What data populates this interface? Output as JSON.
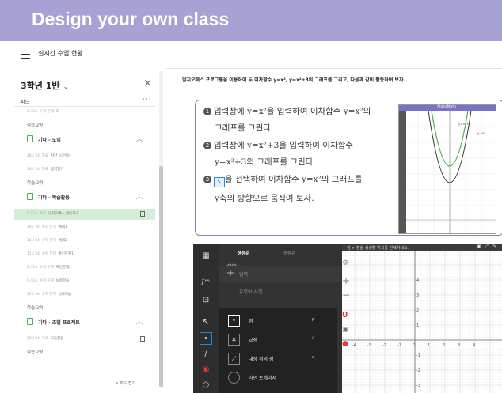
{
  "banner": {
    "title": "Design your own class"
  },
  "topbar": {
    "title": "실시간 수업 현황"
  },
  "sidebar": {
    "class_name": "3학년 1반",
    "class_chevron": "⌄",
    "close": "×",
    "tab": "피드",
    "more": "···",
    "items": [
      {
        "kind": "meta",
        "date": "1 / 24",
        "tag": "수학 문제",
        "title": "도"
      },
      {
        "kind": "plain",
        "text": "학습요약"
      },
      {
        "kind": "section",
        "label": "기타 - 도입"
      },
      {
        "kind": "meta",
        "date": "16 / 24",
        "tag": "자료",
        "title": "지난 시간에는"
      },
      {
        "kind": "meta",
        "date": "16 / 24",
        "tag": "자료",
        "title": "생각열기"
      },
      {
        "kind": "plain",
        "text": "학습요약"
      },
      {
        "kind": "section",
        "label": "기타 - 학습활동"
      },
      {
        "kind": "active",
        "date": "0 / 24",
        "tag": "자료",
        "title": "알지오매스 활동하기"
      },
      {
        "kind": "meta",
        "date": "16 / 24",
        "tag": "수학 문제",
        "title": "예제1"
      },
      {
        "kind": "meta",
        "date": "16 / 24",
        "tag": "수학 문제",
        "title": "예제2"
      },
      {
        "kind": "meta",
        "date": "11 / 24",
        "tag": "수학 문제",
        "title": "확인문제1"
      },
      {
        "kind": "meta",
        "date": "1 / 24",
        "tag": "수학 문제",
        "title": "확인문제2"
      },
      {
        "kind": "meta",
        "date": "0 / 24",
        "tag": "수학 문제",
        "title": "보충학습"
      },
      {
        "kind": "meta",
        "date": "12 / 24",
        "tag": "수학 문제",
        "title": "심화학습"
      },
      {
        "kind": "plain",
        "text": "학습요약"
      },
      {
        "kind": "section",
        "label": "기타 - 조별 프로젝트"
      },
      {
        "kind": "meta",
        "date": "20 / 24",
        "tag": "자료",
        "title": "모둠활동"
      },
      {
        "kind": "plain",
        "text": "학습요약"
      }
    ],
    "collapse": "∧ 피드 접기"
  },
  "content": {
    "instruction": "알지오매스 프로그램을 이용하여 두 이차함수 y=x², y=x²+3의 그래프를 그리고, 다음과 같이 활동하여 보자.",
    "steps": [
      {
        "num": "1",
        "line1": "입력창에 y=x²을 입력하여 이차함수 y=x²의",
        "line2": "그래프를 그린다."
      },
      {
        "num": "2",
        "line1": "입력창에 y=x²+3을 입력하여 이차함수",
        "line2": "y=x²+3의 그래프를 그린다."
      },
      {
        "num": "3",
        "line1a": "",
        "line1b": "을 선택하여 이차함수 y=x²의 그래프를",
        "line2": "y축의 방향으로 움직여 보자."
      }
    ],
    "mini_app_title": "AlgeoMath",
    "mini_labels": [
      "y=x²+3",
      "y=x²"
    ]
  },
  "geo": {
    "tabs": [
      "생성순",
      "종류순"
    ],
    "input_placeholder": "입력",
    "history": "유령어 사전",
    "tools": [
      {
        "label": "점",
        "key": "p"
      },
      {
        "label": "교점",
        "key": "i"
      },
      {
        "label": "대상 위의 점",
        "key": "o"
      },
      {
        "label": "라인 트레이서",
        "key": ""
      }
    ],
    "canvas_hint": "점 > 점을 생성할 위치를 선택하세요.",
    "x_ticks": [
      "-4",
      "-3",
      "-2",
      "-1",
      "0",
      "1",
      "2",
      "3",
      "4"
    ],
    "y_ticks": [
      "4",
      "3",
      "2",
      "1",
      "-1",
      "-2",
      "-3"
    ]
  },
  "colors": {
    "banner": "#a8a1d3",
    "accent": "#8b7fc0",
    "active_row": "#d4ecd9",
    "green": "#4caf50"
  }
}
